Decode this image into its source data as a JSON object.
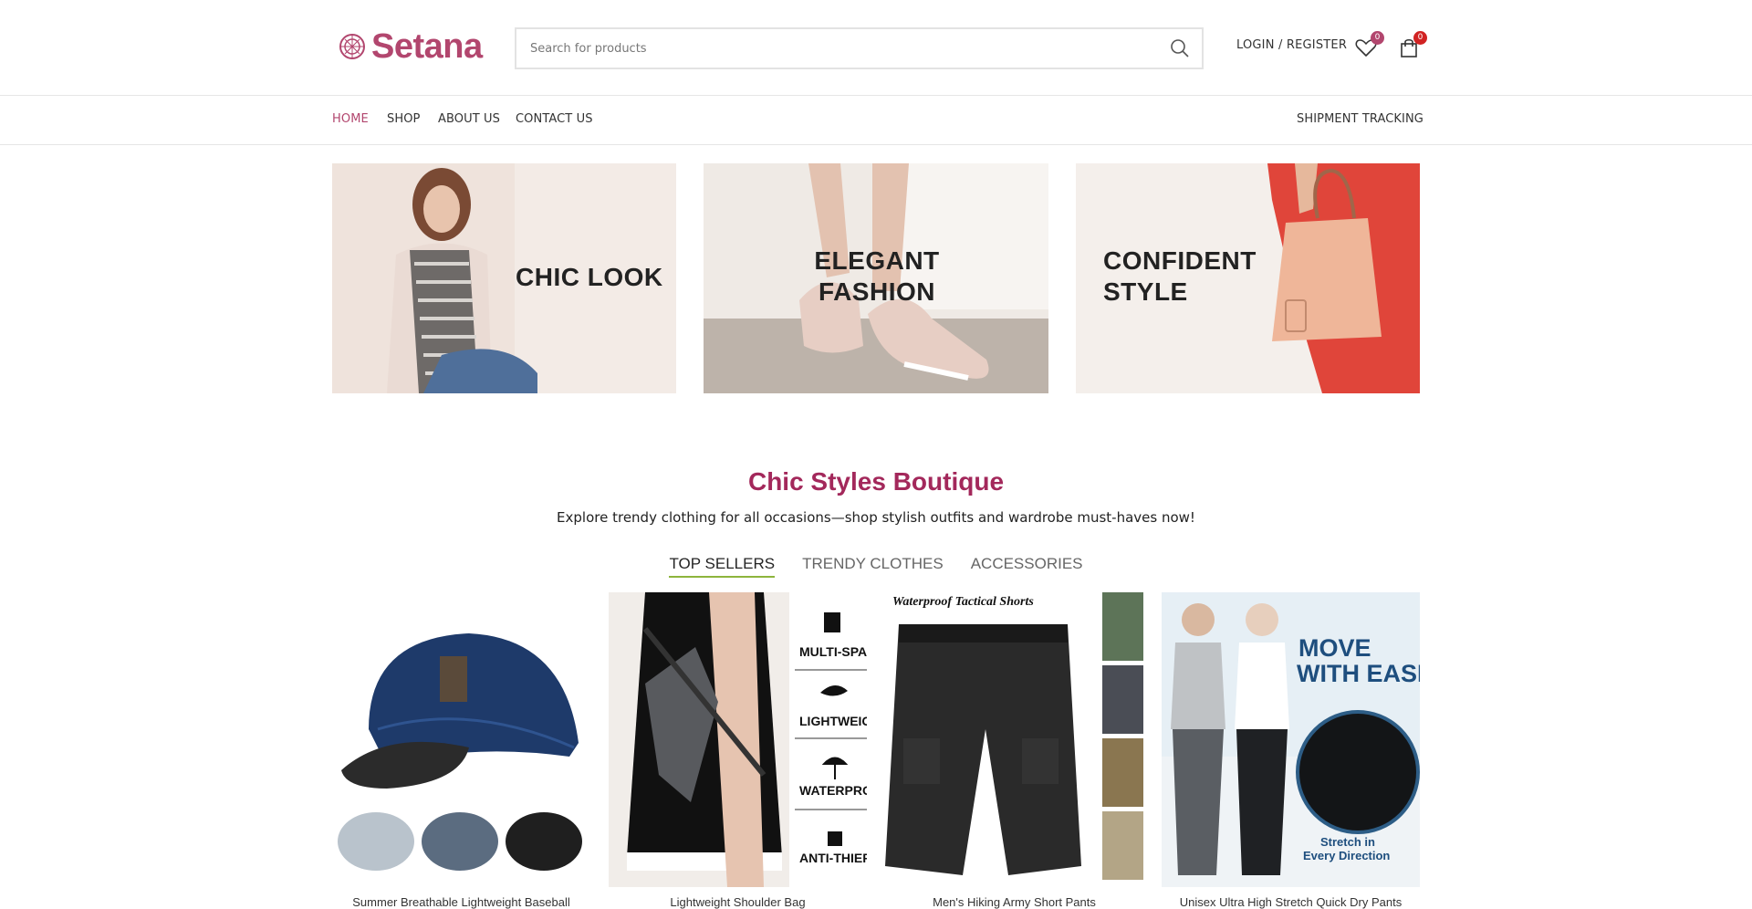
{
  "header": {
    "logo_text": "Setana",
    "search_placeholder": "Search for products",
    "login_label": "LOGIN / REGISTER",
    "wishlist_count": "0",
    "cart_count": "0"
  },
  "nav": {
    "items": [
      {
        "label": "HOME",
        "active": true
      },
      {
        "label": "SHOP"
      },
      {
        "label": "ABOUT US"
      },
      {
        "label": "CONTACT US"
      }
    ],
    "right_label": "SHIPMENT TRACKING"
  },
  "banners": [
    {
      "title": "CHIC LOOK"
    },
    {
      "title": "ELEGANT\nFASHION"
    },
    {
      "title": "CONFIDENT\nSTYLE"
    }
  ],
  "section": {
    "title": "Chic Styles Boutique",
    "subtitle": "Explore trendy clothing for all occasions—shop stylish outfits and wardrobe must-haves now!",
    "tabs": [
      {
        "label": "TOP SELLERS",
        "active": true
      },
      {
        "label": "TRENDY CLOTHES"
      },
      {
        "label": "ACCESSORIES"
      }
    ]
  },
  "products": [
    {
      "name": "Summer Breathable Lightweight Baseball"
    },
    {
      "name": "Lightweight Shoulder Bag",
      "features": [
        "MULTI-SPAC",
        "LIGHTWEIGH",
        "WATERPROO",
        "ANTI-THIEF"
      ]
    },
    {
      "name": "Men's Hiking Army Short Pants",
      "image_caption": "Waterproof Tactical Shorts"
    },
    {
      "name": "Unisex Ultra High Stretch Quick Dry Pants",
      "image_text_1": "MOVE",
      "image_text_2": "WITH EASE",
      "image_text_3": "Stretch in",
      "image_text_4": "Every Direction"
    }
  ],
  "colors": {
    "brand": "#b2466e",
    "section_title": "#a3285b",
    "tab_underline": "#8db53c",
    "cart_badge": "#d12323"
  }
}
